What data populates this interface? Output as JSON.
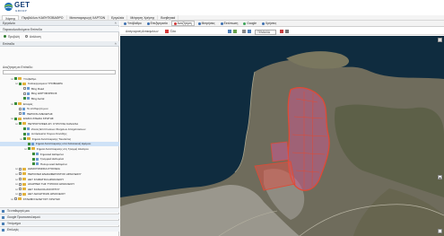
{
  "header": {
    "logo_text": "GET",
    "logo_sub": "GROUP"
  },
  "menubar": {
    "items": [
      "Χάρτης",
      "Περιβάλλον ΚΑΘΥΠΟΒΑΘΡΟ",
      "Μεταπαραγωγή ΧΑΡΤΩΝ",
      "Εργαλεία",
      "Μέτρηση Χρήσης",
      "Βοηθητικά"
    ]
  },
  "left": {
    "section1": "Εργαλεία",
    "sub1": "Παρακολουθούμενα Επίπεδα",
    "radio_label_a": "Προβολή",
    "radio_label_b": "Ανάλυση",
    "section2": "Επίπεδα",
    "search_label": "Αναζήτηση σε Επίπεδο:",
    "tree": [
      {
        "label": "Υπόβαθρο",
        "depth": 2,
        "kind": "folder",
        "checked": true
      },
      {
        "label": "Καλλιεργούμενα ΥΠΟΒΑΘΡΑ",
        "depth": 3,
        "kind": "folder",
        "checked": true
      },
      {
        "label": "Bing Road",
        "depth": 4,
        "kind": "layer",
        "checked": false
      },
      {
        "label": "Bing ΔΟΡΥΦΟΡΙΚΟΣ",
        "depth": 4,
        "kind": "layer",
        "checked": false
      },
      {
        "label": "Bing Aerial",
        "depth": 4,
        "kind": "layer",
        "checked": true
      },
      {
        "label": "Επαφές",
        "depth": 2,
        "kind": "folder",
        "checked": true
      },
      {
        "label": "Το επιθυμητό μου",
        "depth": 3,
        "kind": "layer",
        "checked": false
      },
      {
        "label": "ΠΕΡΙΟΧΗ ΜΕΛΕΤΗΣ",
        "depth": 3,
        "kind": "layer",
        "checked": false
      },
      {
        "label": "ΕΙΔΙΚΑ ΣΧΕΔΙΑ ΚΡΗΤΗΣ",
        "depth": 2,
        "kind": "folder",
        "checked": true
      },
      {
        "label": "ΠΕΤΡΟΓΛΥΦΕΣ ΑΠ. ΚΥΡΟΥΣΗ ΚΑΝΑΛΙΑ",
        "depth": 3,
        "kind": "folder",
        "checked": true
      },
      {
        "label": "Ζώνες Επιπτώσεων Στοιχείων Αποχετεύσεων",
        "depth": 4,
        "kind": "layer",
        "checked": true
      },
      {
        "label": "Αυτόκλειστα Χώρου Συντάξης",
        "depth": 4,
        "kind": "layer",
        "checked": true
      },
      {
        "label": "Σημεία Ανταπόκρισης Τουαλέτας",
        "depth": 4,
        "kind": "folder",
        "checked": true
      },
      {
        "label": "Σημεία Ανταπόκρισης υπό Κατασκευή Δρόμου",
        "depth": 5,
        "kind": "layer",
        "checked": true,
        "selected": true
      },
      {
        "label": "Σημεία Ανταπόκρισης στη Γραμμή Αλλαγών",
        "depth": 5,
        "kind": "folder",
        "checked": true
      },
      {
        "label": "Σημειακά Δεδομένα",
        "depth": 6,
        "kind": "layer",
        "checked": true
      },
      {
        "label": "Γραμμικά Δεδομένα",
        "depth": 6,
        "kind": "layer",
        "checked": true
      },
      {
        "label": "Πολυγωνικά Δεδομένα",
        "depth": 6,
        "kind": "layer",
        "checked": true
      },
      {
        "label": "ΔΗΜΟΓΡΑΦΙΚΑ ΣΤΟΙΧΕΙΑ",
        "depth": 3,
        "kind": "folder",
        "checked": false
      },
      {
        "label": "ΠΕΡΙΟΧΕΣ ΕΝΔΙΑΦΕΡΟΝΤΟΣ ΗΡΑΚΛΕΙΟΥ",
        "depth": 3,
        "kind": "folder",
        "checked": false
      },
      {
        "label": "ΔΕΥ ΚΛΙΜΑΤΙΚΑ ΗΡΑΚΛΕΙΟΥ",
        "depth": 3,
        "kind": "folder",
        "checked": false
      },
      {
        "label": "ΑΚΑΡΠΕΣ ΤΗΣ ΤΥΡΚΙΚΟ ΗΡΑΚΛΕΙΟΥ",
        "depth": 3,
        "kind": "folder",
        "checked": false
      },
      {
        "label": "ΔΕΥ ΚΑΝΑΛΙΑ ΑΝΟΙΧΤΟΥ",
        "depth": 3,
        "kind": "folder",
        "checked": false
      },
      {
        "label": "ΔΕΥ ΑΘΛΗΤΙΚΩΝ ΗΡΑΚΛΕΙΟΥ",
        "depth": 3,
        "kind": "folder",
        "checked": false
      },
      {
        "label": "ΣΤΑΘΜΟΙ ΕΛΕΓΧΟΥ ΚΡΗΤΗΣ",
        "depth": 2,
        "kind": "folder",
        "checked": false
      }
    ],
    "bottom": [
      "Το επιθυμητό μου",
      "Google Προσανατολισμού",
      "Υπόμνημα",
      "Επιλογές"
    ]
  },
  "map": {
    "tabs": [
      "Υπόβαθρο",
      "Επεξεργασία",
      "Αναζήτηση",
      "Μετρήσεις",
      "Εκτύπωση",
      "Google",
      "Χρήστες"
    ],
    "active_tab": 2,
    "subbar": {
      "label": "Αναγνώριση Αντικειμένων",
      "badge": "Όλα",
      "select_value": "ΤΕΜΑΧΙΑ"
    }
  },
  "colors": {
    "sea": "#0f2c3f",
    "land": "#6b6a5b",
    "urban": "#9a978d",
    "parcel_outline": "#e14a34",
    "parcel_fill": "#c65b8d",
    "selected_row": "#cfe2f7",
    "logo": "#0f3b74"
  },
  "icons": [
    "menu-icon",
    "zoom-in-icon",
    "zoom-out-icon",
    "pan-icon",
    "info-icon",
    "layer-icon"
  ]
}
